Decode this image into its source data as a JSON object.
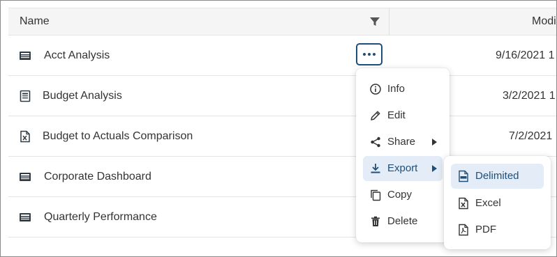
{
  "table": {
    "header": {
      "name_label": "Name",
      "modified_label": "Modi"
    },
    "rows": [
      {
        "name": "Acct Analysis",
        "date": "9/16/2021 1",
        "icon": "dashboard-icon"
      },
      {
        "name": "Budget Analysis",
        "date": "3/2/2021 1",
        "icon": "report-icon"
      },
      {
        "name": "Budget to Actuals Comparison",
        "date": "7/2/2021",
        "icon": "excel-file-icon"
      },
      {
        "name": "Corporate Dashboard",
        "date": "",
        "icon": "dashboard-icon"
      },
      {
        "name": "Quarterly Performance",
        "date": "",
        "icon": "dashboard-icon"
      }
    ]
  },
  "context_menu": {
    "items": [
      {
        "label": "Info",
        "icon": "info-icon"
      },
      {
        "label": "Edit",
        "icon": "pencil-icon"
      },
      {
        "label": "Share",
        "icon": "share-icon",
        "has_submenu": true
      },
      {
        "label": "Export",
        "icon": "download-icon",
        "has_submenu": true,
        "active": true
      },
      {
        "label": "Copy",
        "icon": "copy-icon"
      },
      {
        "label": "Delete",
        "icon": "trash-icon"
      }
    ]
  },
  "export_submenu": {
    "items": [
      {
        "label": "Delimited",
        "icon": "csv-file-icon",
        "active": true
      },
      {
        "label": "Excel",
        "icon": "excel-file-icon"
      },
      {
        "label": "PDF",
        "icon": "pdf-file-icon"
      }
    ]
  },
  "colors": {
    "accent": "#1f4e79",
    "active_bg": "#e3ecf7",
    "header_bg": "#f5f5f5"
  }
}
